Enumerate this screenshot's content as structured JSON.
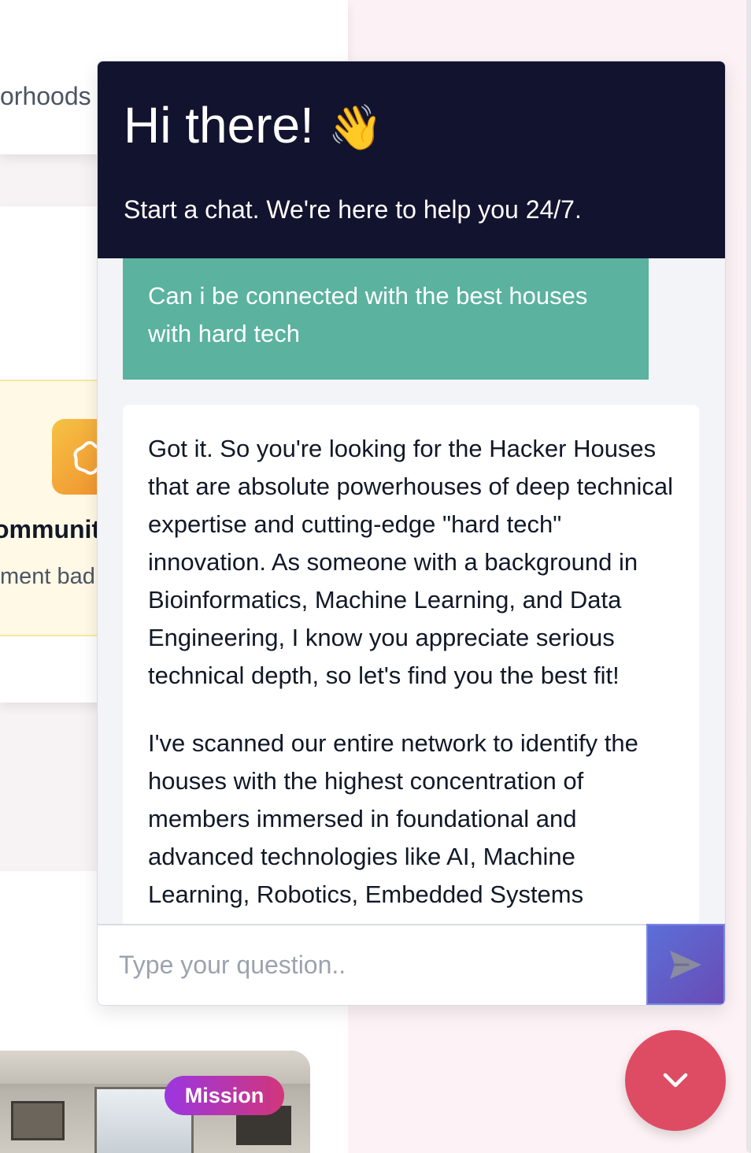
{
  "background": {
    "card_top_text": "orhoods",
    "feature_title": "ommunit",
    "feature_subtitle": "ment bad",
    "badge_label": "Mission"
  },
  "chat": {
    "title": "Hi there!",
    "title_emoji": "👋",
    "subtitle": "Start a chat. We're here to help you 24/7.",
    "messages": [
      {
        "role": "user",
        "text": "Can i be connected with the best houses with hard tech"
      },
      {
        "role": "assistant",
        "paragraphs": [
          "Got it. So you're looking for the Hacker Houses that are absolute powerhouses of deep technical expertise and cutting-edge \"hard tech\" innovation. As someone with a background in Bioinformatics, Machine Learning, and Data Engineering, I know you appreciate serious technical depth, so let's find you the best fit!",
          "I've scanned our entire network to identify the houses with the highest concentration of members immersed in foundational and advanced technologies like AI, Machine Learning, Robotics, Embedded Systems"
        ]
      }
    ],
    "input_placeholder": "Type your question..",
    "send_icon": "send-arrow-icon",
    "toggle_icon": "chevron-down-icon"
  },
  "colors": {
    "header_bg": "#12132e",
    "user_bubble": "#5ab29f",
    "send_button": "#5b6fd8",
    "toggle_button": "#de4c63",
    "badge_gradient": [
      "#9b36e0",
      "#d1367a"
    ]
  }
}
